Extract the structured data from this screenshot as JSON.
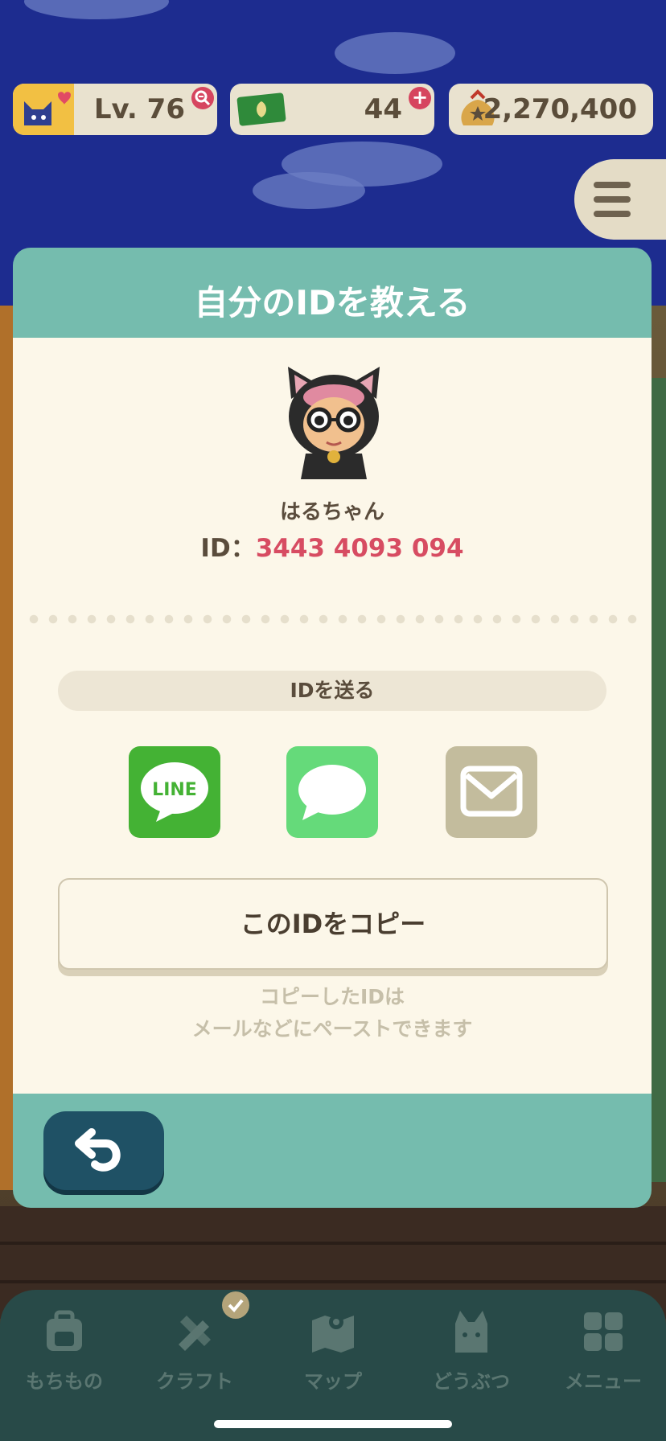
{
  "hud": {
    "level_label": "Lv. 76",
    "tickets_label": "44",
    "bells_label": "2,270,400"
  },
  "dialog": {
    "title": "自分のIDを教える",
    "player_name": "はるちゃん",
    "id_prefix": "ID：",
    "id_value": "3443 4093 094",
    "send_section_label": "IDを送る",
    "share_line_label": "LINE",
    "copy_button_label": "このIDをコピー",
    "hint_line1": "コピーしたIDは",
    "hint_line2": "メールなどにペーストできます"
  },
  "bottom_nav": {
    "items": [
      {
        "label": "もちもの"
      },
      {
        "label": "クラフト"
      },
      {
        "label": "マップ"
      },
      {
        "label": "どうぶつ"
      },
      {
        "label": "メニュー"
      }
    ]
  },
  "colors": {
    "dialog_header": "#75bcae",
    "dialog_body": "#fcf7e9",
    "id_number": "#d74c62",
    "line_green": "#44b234",
    "message_green": "#65da7a",
    "mail_beige": "#c3bc9d",
    "back_button": "#1f5165",
    "nav_background": "#284a48"
  },
  "icons": {
    "hud_level": "cat-heart-icon",
    "hud_level_badge": "zoom-icon",
    "hud_tickets": "leaf-ticket-icon",
    "hud_tickets_badge": "plus-icon",
    "hud_bells": "bell-bag-icon",
    "menu": "hamburger-icon",
    "share": [
      "line-icon",
      "message-icon",
      "mail-icon"
    ],
    "back": "back-arrow-icon",
    "nav": [
      "bag-icon",
      "craft-icon",
      "map-icon",
      "animals-icon",
      "menu-grid-icon"
    ],
    "craft_badge": "check-icon"
  }
}
